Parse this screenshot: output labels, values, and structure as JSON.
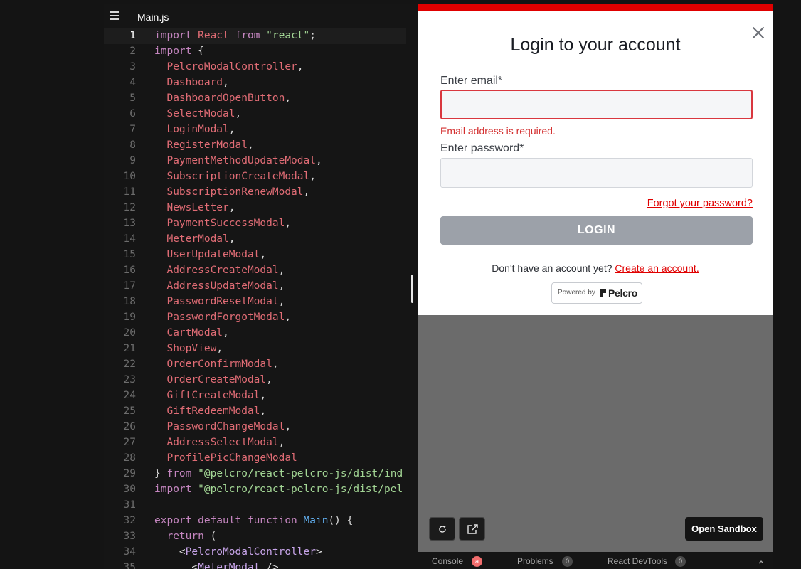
{
  "editor": {
    "tab_label": "Main.js",
    "current_line": 1,
    "lines": [
      {
        "n": "1",
        "tokens": [
          [
            "kw",
            "import "
          ],
          [
            "id",
            "React"
          ],
          [
            "kw",
            " from "
          ],
          [
            "str",
            "\"react\""
          ],
          [
            "pl",
            ";"
          ]
        ]
      },
      {
        "n": "2",
        "tokens": [
          [
            "kw",
            "import "
          ],
          [
            "pl",
            "{"
          ]
        ]
      },
      {
        "n": "3",
        "tokens": [
          [
            "id",
            "  PelcroModalController"
          ],
          [
            "pl",
            ","
          ]
        ]
      },
      {
        "n": "4",
        "tokens": [
          [
            "id",
            "  Dashboard"
          ],
          [
            "pl",
            ","
          ]
        ]
      },
      {
        "n": "5",
        "tokens": [
          [
            "id",
            "  DashboardOpenButton"
          ],
          [
            "pl",
            ","
          ]
        ]
      },
      {
        "n": "6",
        "tokens": [
          [
            "id",
            "  SelectModal"
          ],
          [
            "pl",
            ","
          ]
        ]
      },
      {
        "n": "7",
        "tokens": [
          [
            "id",
            "  LoginModal"
          ],
          [
            "pl",
            ","
          ]
        ]
      },
      {
        "n": "8",
        "tokens": [
          [
            "id",
            "  RegisterModal"
          ],
          [
            "pl",
            ","
          ]
        ]
      },
      {
        "n": "9",
        "tokens": [
          [
            "id",
            "  PaymentMethodUpdateModal"
          ],
          [
            "pl",
            ","
          ]
        ]
      },
      {
        "n": "10",
        "tokens": [
          [
            "id",
            "  SubscriptionCreateModal"
          ],
          [
            "pl",
            ","
          ]
        ]
      },
      {
        "n": "11",
        "tokens": [
          [
            "id",
            "  SubscriptionRenewModal"
          ],
          [
            "pl",
            ","
          ]
        ]
      },
      {
        "n": "12",
        "tokens": [
          [
            "id",
            "  NewsLetter"
          ],
          [
            "pl",
            ","
          ]
        ]
      },
      {
        "n": "13",
        "tokens": [
          [
            "id",
            "  PaymentSuccessModal"
          ],
          [
            "pl",
            ","
          ]
        ]
      },
      {
        "n": "14",
        "tokens": [
          [
            "id",
            "  MeterModal"
          ],
          [
            "pl",
            ","
          ]
        ]
      },
      {
        "n": "15",
        "tokens": [
          [
            "id",
            "  UserUpdateModal"
          ],
          [
            "pl",
            ","
          ]
        ]
      },
      {
        "n": "16",
        "tokens": [
          [
            "id",
            "  AddressCreateModal"
          ],
          [
            "pl",
            ","
          ]
        ]
      },
      {
        "n": "17",
        "tokens": [
          [
            "id",
            "  AddressUpdateModal"
          ],
          [
            "pl",
            ","
          ]
        ]
      },
      {
        "n": "18",
        "tokens": [
          [
            "id",
            "  PasswordResetModal"
          ],
          [
            "pl",
            ","
          ]
        ]
      },
      {
        "n": "19",
        "tokens": [
          [
            "id",
            "  PasswordForgotModal"
          ],
          [
            "pl",
            ","
          ]
        ]
      },
      {
        "n": "20",
        "tokens": [
          [
            "id",
            "  CartModal"
          ],
          [
            "pl",
            ","
          ]
        ]
      },
      {
        "n": "21",
        "tokens": [
          [
            "id",
            "  ShopView"
          ],
          [
            "pl",
            ","
          ]
        ]
      },
      {
        "n": "22",
        "tokens": [
          [
            "id",
            "  OrderConfirmModal"
          ],
          [
            "pl",
            ","
          ]
        ]
      },
      {
        "n": "23",
        "tokens": [
          [
            "id",
            "  OrderCreateModal"
          ],
          [
            "pl",
            ","
          ]
        ]
      },
      {
        "n": "24",
        "tokens": [
          [
            "id",
            "  GiftCreateModal"
          ],
          [
            "pl",
            ","
          ]
        ]
      },
      {
        "n": "25",
        "tokens": [
          [
            "id",
            "  GiftRedeemModal"
          ],
          [
            "pl",
            ","
          ]
        ]
      },
      {
        "n": "26",
        "tokens": [
          [
            "id",
            "  PasswordChangeModal"
          ],
          [
            "pl",
            ","
          ]
        ]
      },
      {
        "n": "27",
        "tokens": [
          [
            "id",
            "  AddressSelectModal"
          ],
          [
            "pl",
            ","
          ]
        ]
      },
      {
        "n": "28",
        "tokens": [
          [
            "id",
            "  ProfilePicChangeModal"
          ]
        ]
      },
      {
        "n": "29",
        "tokens": [
          [
            "pl",
            "} "
          ],
          [
            "kw",
            "from "
          ],
          [
            "str",
            "\"@pelcro/react-pelcro-js/dist/ind"
          ]
        ]
      },
      {
        "n": "30",
        "tokens": [
          [
            "kw",
            "import "
          ],
          [
            "str",
            "\"@pelcro/react-pelcro-js/dist/pel"
          ]
        ]
      },
      {
        "n": "31",
        "tokens": []
      },
      {
        "n": "32",
        "tokens": [
          [
            "kw",
            "export default function "
          ],
          [
            "fn",
            "Main"
          ],
          [
            "pl",
            "() {"
          ]
        ]
      },
      {
        "n": "33",
        "tokens": [
          [
            "kw",
            "  return "
          ],
          [
            "pl",
            "("
          ]
        ]
      },
      {
        "n": "34",
        "tokens": [
          [
            "pl",
            "    <"
          ],
          [
            "tg",
            "PelcroModalController"
          ],
          [
            "pl",
            ">"
          ]
        ]
      },
      {
        "n": "35",
        "tokens": [
          [
            "pl",
            "      <"
          ],
          [
            "tg",
            "MeterModal"
          ],
          [
            "pl",
            " />"
          ]
        ]
      }
    ]
  },
  "modal": {
    "title": "Login to your account",
    "email_label": "Enter email*",
    "email_value": "",
    "email_error": "Email address is required.",
    "password_label": "Enter password*",
    "password_value": "",
    "forgot_link": "Forgot your password?",
    "login_button": "LOGIN",
    "signup_prompt": "Don't have an account yet?",
    "signup_link": "Create an account.",
    "powered_by": "Powered by",
    "powered_brand": "Pelcro",
    "accent_color": "#e00000",
    "close_icon": "close-icon"
  },
  "preview_controls": {
    "refresh_icon": "refresh-icon",
    "open_external_icon": "external-link-icon",
    "open_sandbox": "Open Sandbox"
  },
  "bottom_bar": {
    "tabs": [
      {
        "label": "Console",
        "count": "a"
      },
      {
        "label": "Problems",
        "count": "0"
      },
      {
        "label": "React DevTools",
        "count": "0"
      }
    ]
  }
}
